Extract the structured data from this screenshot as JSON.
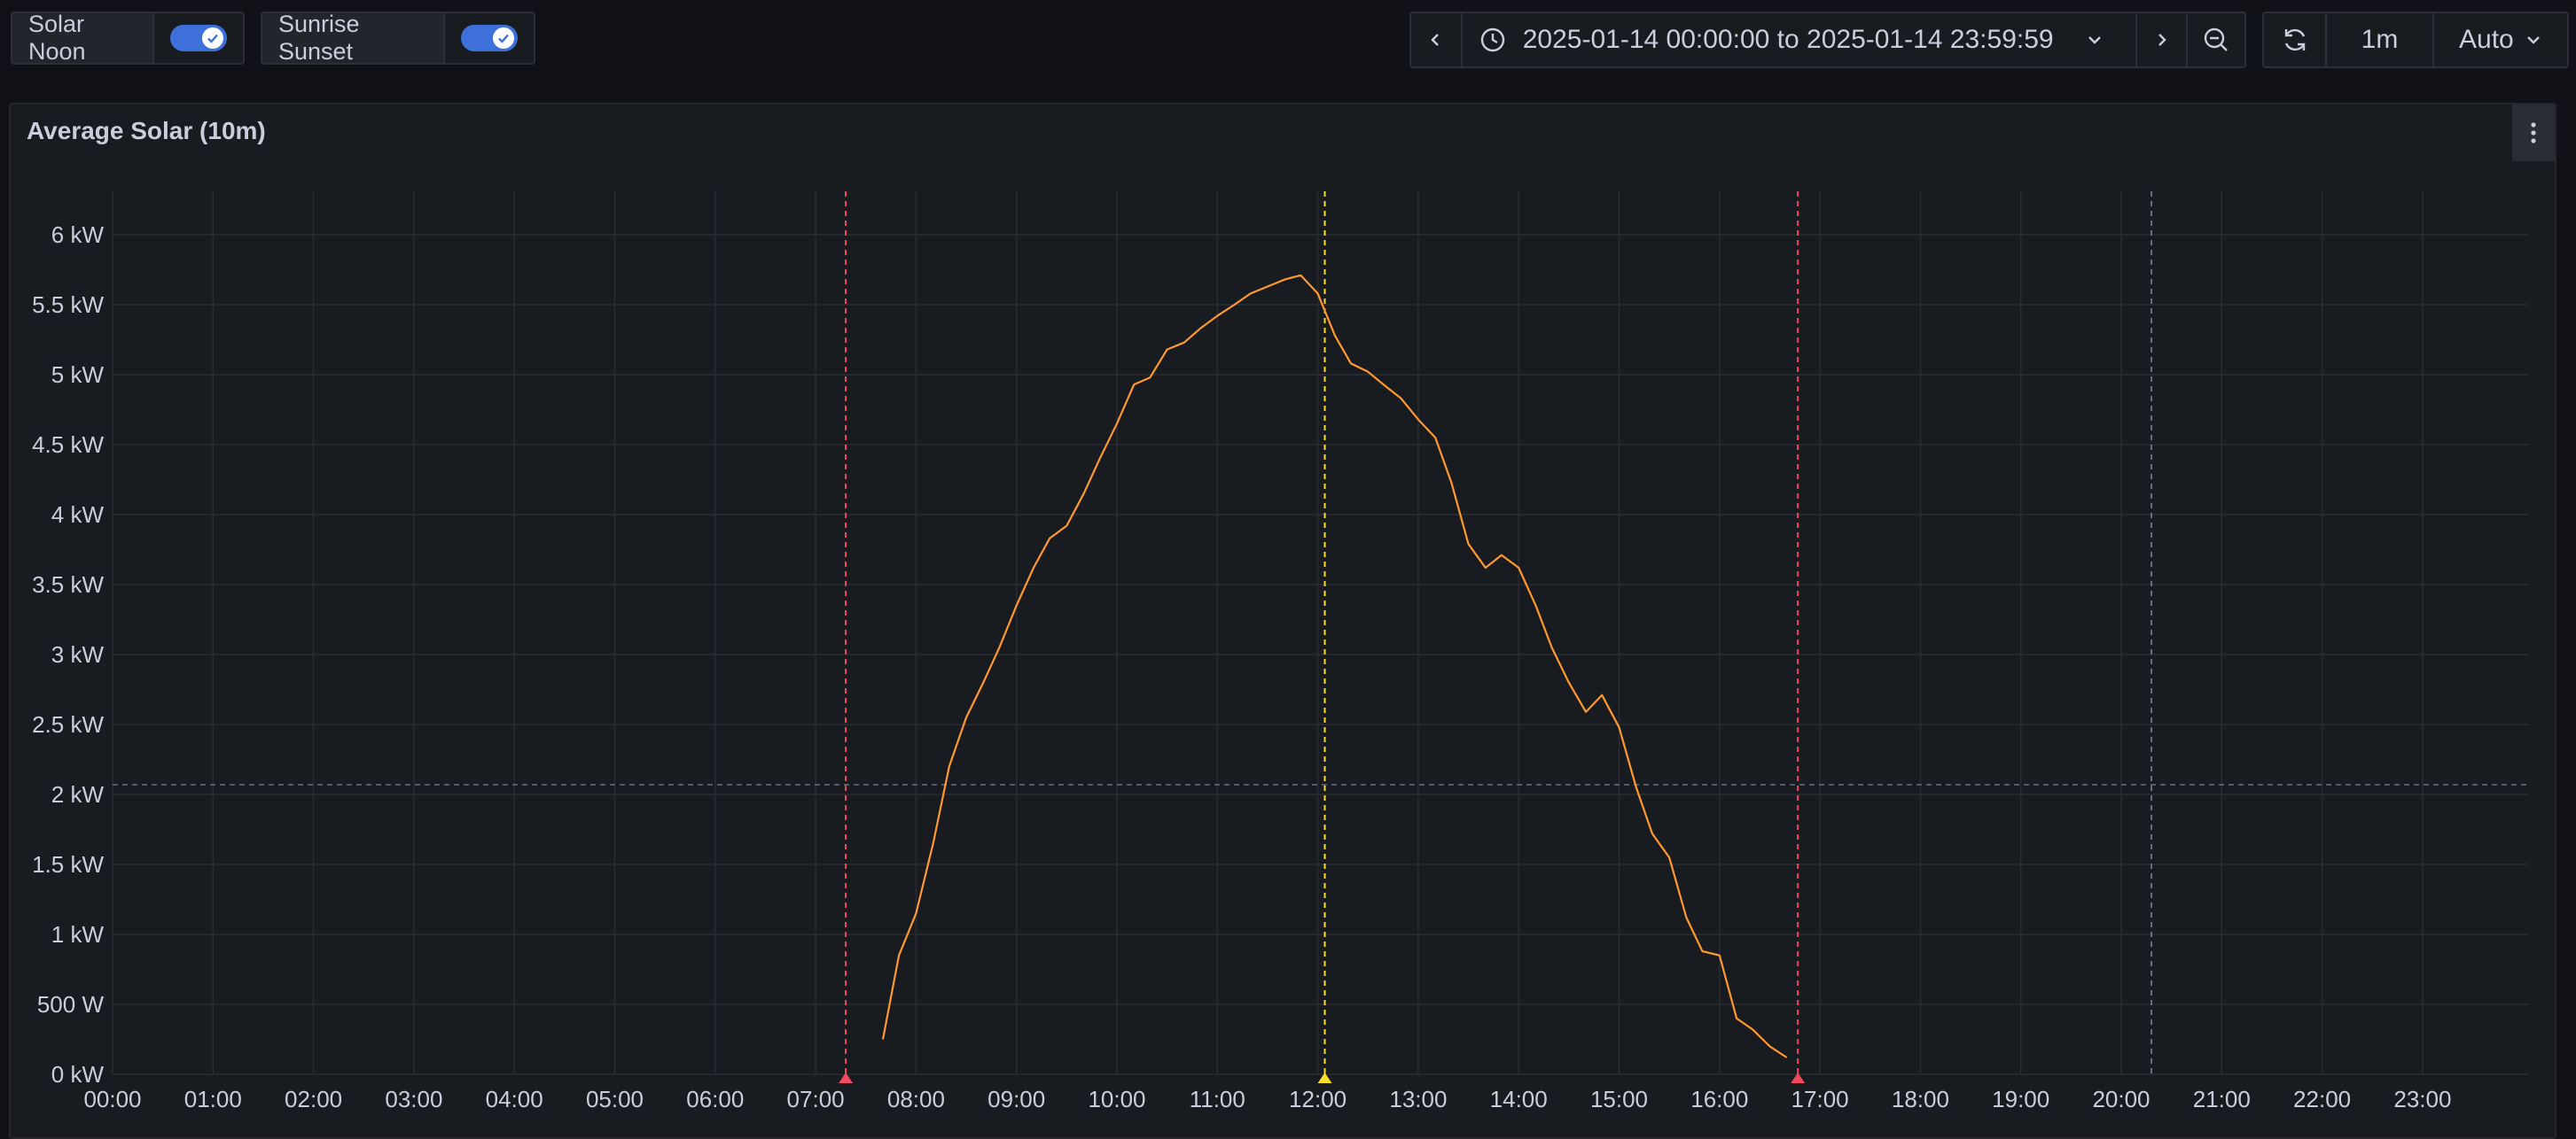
{
  "variables": [
    {
      "label": "Solar Noon",
      "enabled": true
    },
    {
      "label": "Sunrise Sunset",
      "enabled": true
    }
  ],
  "time_range": {
    "prev_icon": "chevron-left-icon",
    "clock_icon": "clock-icon",
    "label": "2025-01-14 00:00:00 to 2025-01-14 23:59:59",
    "dropdown_icon": "chevron-down-icon",
    "next_icon": "chevron-right-icon",
    "zoom_icon": "zoom-out-icon"
  },
  "refresh": {
    "icon": "refresh-icon",
    "label": "1m",
    "interval": "Auto"
  },
  "panel": {
    "title": "Average Solar (10m)",
    "menu_icon": "kebab-menu-icon"
  },
  "colors": {
    "series": "#ff9830",
    "sunrise_sunset": "#f2495c",
    "solar_noon": "#fade2a",
    "threshold": "#6e6e7a"
  },
  "chart_data": {
    "type": "line",
    "x_unit": "hours",
    "xlim": [
      0,
      24.75
    ],
    "ylim": [
      0,
      6.25
    ],
    "y_ticks": [
      {
        "v": 0,
        "label": "0 kW"
      },
      {
        "v": 0.5,
        "label": "500 W"
      },
      {
        "v": 1,
        "label": "1 kW"
      },
      {
        "v": 1.5,
        "label": "1.5 kW"
      },
      {
        "v": 2,
        "label": "2 kW"
      },
      {
        "v": 2.5,
        "label": "2.5 kW"
      },
      {
        "v": 3,
        "label": "3 kW"
      },
      {
        "v": 3.5,
        "label": "3.5 kW"
      },
      {
        "v": 4,
        "label": "4 kW"
      },
      {
        "v": 4.5,
        "label": "4.5 kW"
      },
      {
        "v": 5,
        "label": "5 kW"
      },
      {
        "v": 5.5,
        "label": "5.5 kW"
      },
      {
        "v": 6,
        "label": "6 kW"
      }
    ],
    "x_ticks": [
      {
        "v": 0,
        "label": "00:00"
      },
      {
        "v": 1,
        "label": "01:00"
      },
      {
        "v": 2,
        "label": "02:00"
      },
      {
        "v": 3,
        "label": "03:00"
      },
      {
        "v": 4,
        "label": "04:00"
      },
      {
        "v": 5,
        "label": "05:00"
      },
      {
        "v": 6,
        "label": "06:00"
      },
      {
        "v": 7,
        "label": "07:00"
      },
      {
        "v": 8,
        "label": "08:00"
      },
      {
        "v": 9,
        "label": "09:00"
      },
      {
        "v": 10,
        "label": "10:00"
      },
      {
        "v": 11,
        "label": "11:00"
      },
      {
        "v": 12,
        "label": "12:00"
      },
      {
        "v": 13,
        "label": "13:00"
      },
      {
        "v": 14,
        "label": "14:00"
      },
      {
        "v": 15,
        "label": "15:00"
      },
      {
        "v": 16,
        "label": "16:00"
      },
      {
        "v": 17,
        "label": "17:00"
      },
      {
        "v": 18,
        "label": "18:00"
      },
      {
        "v": 19,
        "label": "19:00"
      },
      {
        "v": 20,
        "label": "20:00"
      },
      {
        "v": 21,
        "label": "21:00"
      },
      {
        "v": 22,
        "label": "22:00"
      },
      {
        "v": 23,
        "label": "23:00"
      }
    ],
    "series": [
      {
        "points": [
          [
            7.67,
            0.25
          ],
          [
            7.83,
            0.85
          ],
          [
            8.0,
            1.15
          ],
          [
            8.17,
            1.65
          ],
          [
            8.33,
            2.2
          ],
          [
            8.5,
            2.55
          ],
          [
            8.67,
            2.8
          ],
          [
            8.83,
            3.05
          ],
          [
            9.0,
            3.35
          ],
          [
            9.17,
            3.62
          ],
          [
            9.33,
            3.83
          ],
          [
            9.5,
            3.92
          ],
          [
            9.67,
            4.15
          ],
          [
            9.83,
            4.4
          ],
          [
            10.0,
            4.65
          ],
          [
            10.17,
            4.93
          ],
          [
            10.33,
            4.98
          ],
          [
            10.5,
            5.18
          ],
          [
            10.67,
            5.23
          ],
          [
            10.83,
            5.33
          ],
          [
            11.0,
            5.42
          ],
          [
            11.17,
            5.5
          ],
          [
            11.33,
            5.58
          ],
          [
            11.5,
            5.63
          ],
          [
            11.67,
            5.68
          ],
          [
            11.83,
            5.71
          ],
          [
            12.0,
            5.58
          ],
          [
            12.17,
            5.28
          ],
          [
            12.33,
            5.08
          ],
          [
            12.5,
            5.02
          ],
          [
            12.67,
            4.92
          ],
          [
            12.83,
            4.83
          ],
          [
            13.0,
            4.68
          ],
          [
            13.17,
            4.55
          ],
          [
            13.33,
            4.23
          ],
          [
            13.5,
            3.79
          ],
          [
            13.67,
            3.62
          ],
          [
            13.83,
            3.71
          ],
          [
            14.0,
            3.62
          ],
          [
            14.17,
            3.35
          ],
          [
            14.33,
            3.05
          ],
          [
            14.5,
            2.8
          ],
          [
            14.67,
            2.59
          ],
          [
            14.83,
            2.71
          ],
          [
            15.0,
            2.48
          ],
          [
            15.17,
            2.05
          ],
          [
            15.33,
            1.72
          ],
          [
            15.5,
            1.55
          ],
          [
            15.67,
            1.12
          ],
          [
            15.83,
            0.88
          ],
          [
            16.0,
            0.85
          ],
          [
            16.17,
            0.4
          ],
          [
            16.33,
            0.32
          ],
          [
            16.5,
            0.2
          ],
          [
            16.67,
            0.12
          ]
        ]
      }
    ],
    "annotations": [
      {
        "kind": "sunrise",
        "x": 7.3
      },
      {
        "kind": "solar_noon",
        "x": 12.07
      },
      {
        "kind": "sunset",
        "x": 16.78
      },
      {
        "kind": "marker",
        "x": 20.3
      }
    ],
    "threshold_y": 2.07
  }
}
